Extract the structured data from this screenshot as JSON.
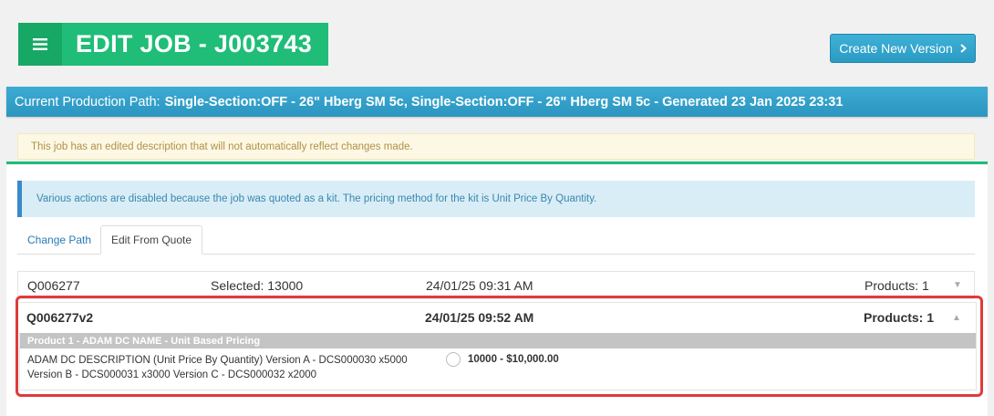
{
  "header": {
    "title": "EDIT JOB - J003743",
    "menu_icon": "hamburger-menu-icon",
    "create_button_label": "Create New Version",
    "create_button_icon": "chevron-right-icon"
  },
  "production_path": {
    "label": "Current Production Path:",
    "value": "Single-Section:OFF - 26\" Hberg SM 5c, Single-Section:OFF - 26\" Hberg SM 5c - Generated 23 Jan 2025 23:31"
  },
  "alerts": {
    "warning": "This job has an edited description that will not automatically reflect changes made.",
    "info": "Various actions are disabled because the job was quoted as a kit. The pricing method for the kit is Unit Price By Quantity."
  },
  "tabs": [
    {
      "label": "Change Path",
      "active": false
    },
    {
      "label": "Edit From Quote",
      "active": true
    }
  ],
  "quotes": [
    {
      "id": "Q006277",
      "selected": "Selected: 13000",
      "date": "24/01/25 09:31 AM",
      "products": "Products: 1",
      "expanded": false
    },
    {
      "id": "Q006277v2",
      "selected": "",
      "date": "24/01/25 09:52 AM",
      "products": "Products: 1",
      "expanded": true,
      "product": {
        "header": "Product 1 - ADAM DC NAME - Unit Based Pricing",
        "description": "ADAM DC DESCRIPTION (Unit Price By Quantity) Version A - DCS000030 x5000 Version B - DCS000031 x3000 Version C - DCS000032 x2000",
        "price_option": "10000 - $10,000.00"
      }
    }
  ],
  "colors": {
    "brand_green": "#1fbd77",
    "path_bar_blue": "#2b96c0",
    "highlight_red": "#de3b3b"
  }
}
